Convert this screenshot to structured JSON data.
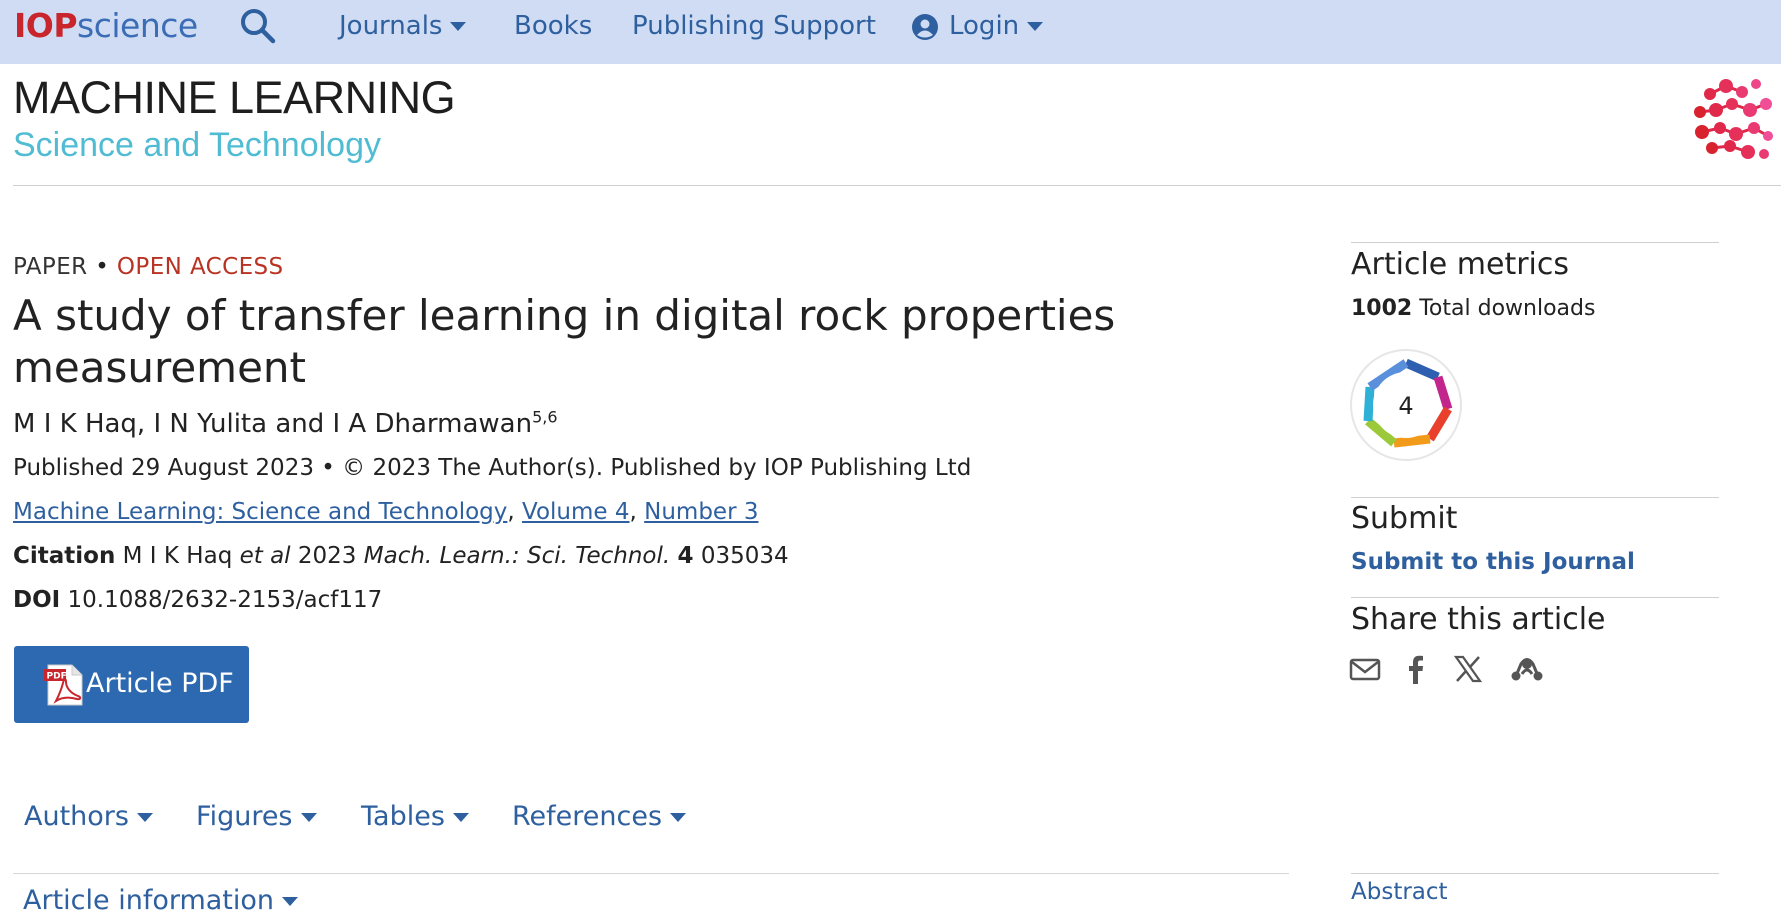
{
  "nav": {
    "logo_iop": "IOP",
    "logo_science": "science",
    "search_icon": "search-icon",
    "items": [
      {
        "label": "Journals",
        "has_caret": true
      },
      {
        "label": "Books",
        "has_caret": false
      },
      {
        "label": "Publishing Support",
        "has_caret": false
      },
      {
        "label": "Login",
        "has_caret": true,
        "icon": "user-circle-icon"
      }
    ],
    "bg_color": "#cfdcf3",
    "link_color": "#2e5f9e"
  },
  "journal": {
    "title": "MACHINE LEARNING",
    "subtitle": "Science and Technology",
    "subtitle_color": "#4fbcd3",
    "logo_icon": "molecule-dots-logo"
  },
  "article": {
    "type_label": "PAPER",
    "separator": "•",
    "access_label": "OPEN ACCESS",
    "access_color": "#b83323",
    "title": "A study of transfer learning in digital rock properties measurement",
    "authors": "M I K Haq, I N Yulita and I A Dharmawan",
    "authors_sup": "5,6",
    "published": "Published 29 August 2023 • © 2023 The Author(s). Published by IOP Publishing Ltd",
    "journal_link": "Machine Learning: Science and Technology",
    "volume_link": "Volume 4",
    "number_link": "Number 3",
    "citation_label": "Citation",
    "citation_authors": "M I K Haq",
    "citation_etal": "et al",
    "citation_year": "2023",
    "citation_journal": "Mach. Learn.: Sci. Technol.",
    "citation_volume": "4",
    "citation_number": "035034",
    "doi_label": "DOI",
    "doi_value": "10.1088/2632-2153/acf117",
    "pdf_button": "Article PDF",
    "pdf_icon": "pdf-file-icon"
  },
  "tabs": [
    {
      "label": "Authors"
    },
    {
      "label": "Figures"
    },
    {
      "label": "Tables"
    },
    {
      "label": "References"
    }
  ],
  "article_info": "Article information",
  "sidebar": {
    "metrics_heading": "Article metrics",
    "downloads_count": "1002",
    "downloads_label": "Total downloads",
    "altmetric_score": "4",
    "submit_heading": "Submit",
    "submit_link": "Submit to this Journal",
    "share_heading": "Share this article",
    "share_icons": [
      "email-icon",
      "facebook-icon",
      "x-twitter-icon",
      "mendeley-icon"
    ],
    "abstract_link": "Abstract"
  }
}
